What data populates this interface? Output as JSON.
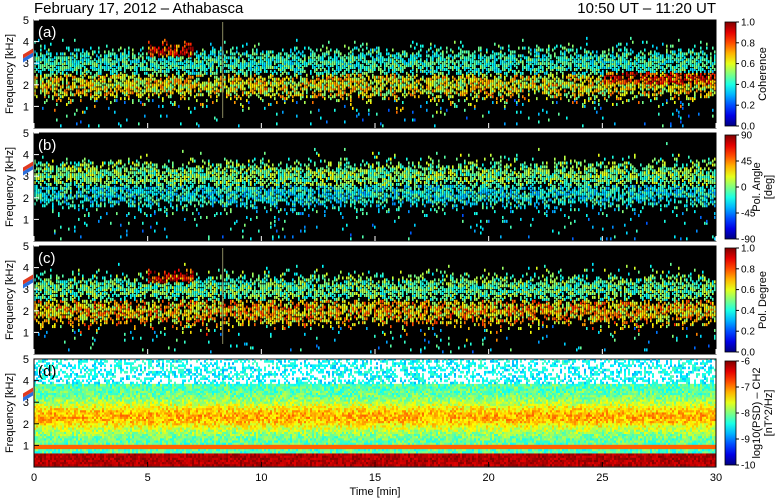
{
  "header": {
    "left": "February 17, 2012 – Athabasca",
    "right": "10:50 UT – 11:20 UT"
  },
  "chart_data": [
    {
      "type": "heatmap",
      "panel_label": "(a)",
      "ylabel": "Frequency [kHz]",
      "ylim": [
        0,
        5
      ],
      "yticks": [
        1,
        2,
        3,
        4,
        5
      ],
      "xlim": [
        0,
        30
      ],
      "colorbar": {
        "label": "Coherence",
        "range": [
          0.0,
          1.0
        ],
        "ticks": [
          "1.0",
          "0.8",
          "0.6",
          "0.4",
          "0.2",
          "0.0"
        ]
      },
      "background": "#000000",
      "features": [
        {
          "name": "band-1",
          "freq_khz": 2.0,
          "t_range": [
            0,
            30
          ],
          "level": 0.65
        },
        {
          "name": "band-2",
          "freq_khz": 3.0,
          "t_range": [
            0,
            30
          ],
          "level": 0.45
        },
        {
          "name": "burst",
          "freq_khz": 3.5,
          "t_range": [
            5,
            7
          ],
          "level": 0.9
        },
        {
          "name": "late-band",
          "freq_khz": 2.1,
          "t_range": [
            25,
            30
          ],
          "level": 0.85
        }
      ]
    },
    {
      "type": "heatmap",
      "panel_label": "(b)",
      "ylabel": "Frequency [kHz]",
      "ylim": [
        0,
        5
      ],
      "yticks": [
        1,
        2,
        3,
        4,
        5
      ],
      "xlim": [
        0,
        30
      ],
      "colorbar": {
        "label": "Pol. Angle [deg]",
        "range": [
          -90,
          90
        ],
        "ticks": [
          "90",
          "45",
          "0",
          "-45",
          "-90"
        ]
      },
      "background": "#000000",
      "features": [
        {
          "name": "band-1",
          "freq_khz": 2.2,
          "t_range": [
            0,
            30
          ],
          "angle_deg": -20
        },
        {
          "name": "band-2",
          "freq_khz": 3.0,
          "t_range": [
            0,
            30
          ],
          "angle_deg": 0
        }
      ]
    },
    {
      "type": "heatmap",
      "panel_label": "(c)",
      "ylabel": "Frequency [kHz]",
      "ylim": [
        0,
        5
      ],
      "yticks": [
        1,
        2,
        3,
        4,
        5
      ],
      "xlim": [
        0,
        30
      ],
      "colorbar": {
        "label": "Pol. Degree",
        "range": [
          0.0,
          1.0
        ],
        "ticks": [
          "1.0",
          "0.8",
          "0.6",
          "0.4",
          "0.2",
          "0.0"
        ]
      },
      "background": "#000000",
      "features": [
        {
          "name": "band-1",
          "freq_khz": 2.0,
          "t_range": [
            0,
            30
          ],
          "level": 0.7
        },
        {
          "name": "band-2",
          "freq_khz": 3.0,
          "t_range": [
            0,
            30
          ],
          "level": 0.5
        },
        {
          "name": "burst",
          "freq_khz": 3.5,
          "t_range": [
            5,
            7
          ],
          "level": 0.9
        },
        {
          "name": "late-band",
          "freq_khz": 2.0,
          "t_range": [
            25,
            30
          ],
          "level": 0.85
        }
      ]
    },
    {
      "type": "heatmap",
      "panel_label": "(d)",
      "ylabel": "Frequency [kHz]",
      "ylim": [
        0,
        5
      ],
      "yticks": [
        1,
        2,
        3,
        4,
        5
      ],
      "xlim": [
        0,
        30
      ],
      "xticks": [
        0,
        5,
        10,
        15,
        20,
        25,
        30
      ],
      "xlabel": "Time [min]",
      "colorbar": {
        "label": "log10(PSD) – CH2 [nT^2/Hz]",
        "range": [
          -10,
          -6
        ],
        "ticks": [
          "-6",
          "-7",
          "-8",
          "-9",
          "-10"
        ]
      },
      "background": "#ffffff",
      "features": [
        {
          "name": "band",
          "freq_khz": 2.3,
          "t_range": [
            0,
            30
          ],
          "log_psd": -7.9
        },
        {
          "name": "line",
          "freq_khz": 0.9,
          "t_range": [
            0,
            30
          ],
          "log_psd": -7.2
        },
        {
          "name": "floor",
          "freq_khz": 0.3,
          "t_range": [
            0,
            30
          ],
          "log_psd": -6.3
        }
      ]
    }
  ],
  "shared": {
    "xlabel": "Time [min]",
    "xtick_labels": [
      "0",
      "5",
      "10",
      "15",
      "20",
      "25",
      "30"
    ],
    "ytick_labels": [
      "1",
      "2",
      "3",
      "4",
      "5"
    ],
    "colors": {
      "jet_start": "#00008f",
      "jet_end": "#800000"
    }
  }
}
